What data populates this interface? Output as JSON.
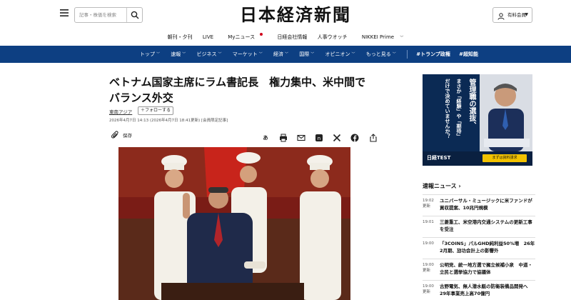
{
  "header": {
    "logo": "日本経済新聞",
    "search_placeholder": "記事・株価を検索",
    "member_label": "有料会員",
    "menu_icon": "menu-icon",
    "search_icon": "search-icon",
    "user_icon": "user-icon"
  },
  "subnav": {
    "items": [
      "朝刊・夕刊",
      "LIVE",
      "Myニュース",
      "日経会社情報",
      "人事ウオッチ",
      "NIKKEI Prime"
    ]
  },
  "mainnav": {
    "items": [
      "トップ",
      "速報",
      "ビジネス",
      "マーケット",
      "経済",
      "国際",
      "オピニオン",
      "もっと見る"
    ],
    "tags": [
      "#トランプ政権",
      "#超知能"
    ],
    "bg_color": "#0d3f82"
  },
  "article": {
    "headline": "ベトナム国家主席にラム書記長　権力集中、米中間でバランス外交",
    "topic": "東南アジア",
    "follow_label": "フォローする",
    "dateline": "2026年4月7日 14:13 (2026年4月7日 18:41更新) [会員限定記事]",
    "save_label": "保存",
    "share_icons": [
      "font-size-icon",
      "print-icon",
      "mail-icon",
      "note-icon",
      "x-icon",
      "facebook-icon",
      "share-icon"
    ]
  },
  "ad": {
    "line1": "管理職の選抜、",
    "line2": "まさか「経験」や「期待」",
    "line3": "だけで決めていませんか？",
    "brand": "日経TEST",
    "cta": "まずは資料請求"
  },
  "breaking_news": {
    "heading": "速報ニュース",
    "items": [
      {
        "time": "19:02",
        "updated": "更新",
        "title": "ユニバーサル・ミュージックに米ファンドが買収提案、10兆円規模"
      },
      {
        "time": "19:01",
        "updated": "",
        "title": "三菱重工、米空港内交通システムの更新工事を受注"
      },
      {
        "time": "19:00",
        "updated": "",
        "title": "「3COINS」パルGHD純利益50%増　26年2月期、劢功会計上の影響外"
      },
      {
        "time": "19:00",
        "updated": "更新",
        "title": "公明党、統一地方選で擁立候補小泉　中道・立民と選挙協力で協議体"
      },
      {
        "time": "19:00",
        "updated": "更新",
        "title": "古野電気、無人潜水艇の防衛装備品開発へ　29年事業売上高70億円"
      }
    ]
  }
}
